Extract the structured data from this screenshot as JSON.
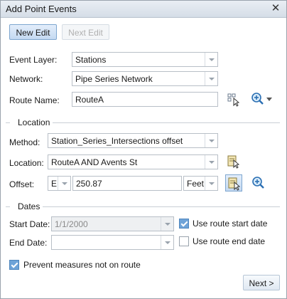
{
  "window": {
    "title": "Add Point Events",
    "close_glyph": "✕"
  },
  "toolbar": {
    "new_edit": "New Edit",
    "next_edit": "Next Edit"
  },
  "form": {
    "event_layer_label": "Event Layer:",
    "event_layer_value": "Stations",
    "network_label": "Network:",
    "network_value": "Pipe Series Network",
    "route_name_label": "Route Name:",
    "route_name_value": "RouteA"
  },
  "location": {
    "section_title": "Location",
    "method_label": "Method:",
    "method_value": "Station_Series_Intersections offset",
    "location_label": "Location:",
    "location_value": "RouteA AND Avents St",
    "offset_label": "Offset:",
    "offset_direction": "E",
    "offset_value": "250.87",
    "offset_units": "Feet"
  },
  "dates": {
    "section_title": "Dates",
    "start_date_label": "Start Date:",
    "start_date_value": "1/1/2000",
    "use_route_start_label": "Use route start date",
    "use_route_start_checked": true,
    "end_date_label": "End Date:",
    "end_date_value": "",
    "use_route_end_label": "Use route end date",
    "use_route_end_checked": false
  },
  "prevent": {
    "label": "Prevent measures not on route",
    "checked": true
  },
  "footer": {
    "next_label": "Next >"
  }
}
